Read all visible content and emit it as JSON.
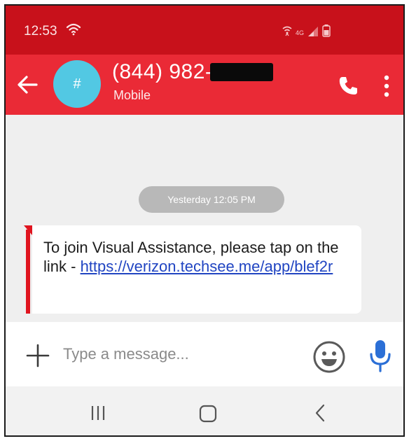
{
  "status_bar": {
    "time": "12:53",
    "network_label": "4G",
    "icons": [
      "wifi-calling-icon",
      "hotspot-icon",
      "signal-icon",
      "battery-icon"
    ]
  },
  "header": {
    "contact_number": "(844) 982-",
    "contact_type": "Mobile",
    "avatar_initial": "#",
    "avatar_color": "#52c8e3",
    "bar_color": "#ea2a36",
    "icons": [
      "back-arrow-icon",
      "phone-icon",
      "more-vert-icon"
    ]
  },
  "conversation": {
    "date_label": "Yesterday 12:05 PM",
    "message": {
      "text": "To join Visual Assistance, please tap on the link - ",
      "link": "https://verizon.techsee.me/app/blef2r",
      "accent_color": "#e0141f"
    }
  },
  "compose": {
    "placeholder": "Type a message...",
    "icons": [
      "plus-icon",
      "emoji-icon",
      "mic-icon"
    ],
    "mic_color": "#2b6fd6"
  },
  "nav_bar": {
    "icons": [
      "recents-icon",
      "home-icon",
      "back-chevron-icon"
    ]
  }
}
